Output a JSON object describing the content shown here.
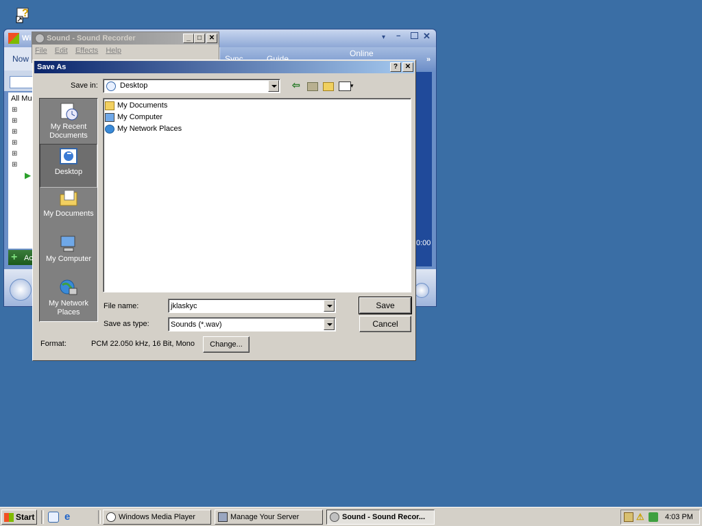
{
  "desktop": {
    "icon_name": "help-shortcut-icon"
  },
  "wmp": {
    "title": "Windows Media Player",
    "title_visible": "Wi",
    "nav_now": "Now",
    "tabs": [
      "Sync",
      "Guide",
      "Online"
    ],
    "library_header": "All Mu",
    "time": "0:00",
    "add_label": "Ac"
  },
  "recorder": {
    "title": "Sound - Sound Recorder",
    "menu": [
      "File",
      "Edit",
      "Effects",
      "Help"
    ]
  },
  "dialog": {
    "title": "Save As",
    "save_in_label": "Save in:",
    "save_in_value": "Desktop",
    "places": [
      {
        "label": "My Recent Documents",
        "icon": "recent-documents-icon"
      },
      {
        "label": "Desktop",
        "icon": "desktop-icon"
      },
      {
        "label": "My Documents",
        "icon": "my-documents-icon"
      },
      {
        "label": "My Computer",
        "icon": "my-computer-icon"
      },
      {
        "label": "My Network Places",
        "icon": "network-places-icon"
      }
    ],
    "files": [
      {
        "name": "My Documents",
        "icon": "folder-icon"
      },
      {
        "name": "My Computer",
        "icon": "computer-icon"
      },
      {
        "name": "My Network Places",
        "icon": "network-icon"
      }
    ],
    "file_name_label": "File name:",
    "file_name_value": "jklaskyc",
    "save_type_label": "Save as type:",
    "save_type_value": "Sounds (*.wav)",
    "save_button": "Save",
    "cancel_button": "Cancel",
    "format_label": "Format:",
    "format_value": "PCM 22.050 kHz, 16 Bit, Mono",
    "change_button": "Change..."
  },
  "taskbar": {
    "start_label": "Start",
    "tasks": [
      {
        "label": "Windows Media Player",
        "active": false
      },
      {
        "label": "Manage Your Server",
        "active": false
      },
      {
        "label": "Sound - Sound Recor...",
        "active": true
      }
    ],
    "clock": "4:03 PM"
  }
}
